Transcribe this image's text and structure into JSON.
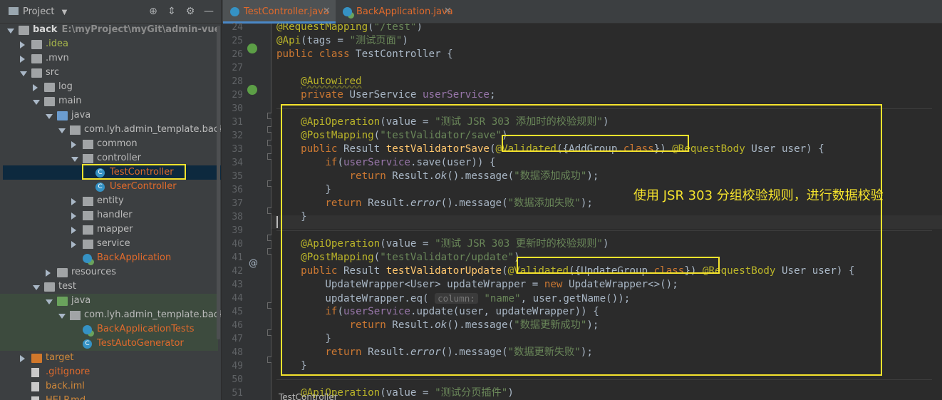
{
  "project_panel": {
    "title": "Project",
    "tree": [
      {
        "label": "back",
        "path": "E:\\myProject\\myGit\\admin-vue-template",
        "depth": 0,
        "arrow": "down",
        "icon": "folder"
      },
      {
        "label": ".idea",
        "depth": 1,
        "arrow": "right",
        "icon": "folder",
        "color": "olive"
      },
      {
        "label": ".mvn",
        "depth": 1,
        "arrow": "right",
        "icon": "folder"
      },
      {
        "label": "src",
        "depth": 1,
        "arrow": "down",
        "icon": "folder"
      },
      {
        "label": "log",
        "depth": 2,
        "arrow": "right",
        "icon": "folder"
      },
      {
        "label": "main",
        "depth": 2,
        "arrow": "down",
        "icon": "folder"
      },
      {
        "label": "java",
        "depth": 3,
        "arrow": "down",
        "icon": "folder-blue"
      },
      {
        "label": "com.lyh.admin_template.back",
        "depth": 4,
        "arrow": "down",
        "icon": "package"
      },
      {
        "label": "common",
        "depth": 5,
        "arrow": "right",
        "icon": "package"
      },
      {
        "label": "controller",
        "depth": 5,
        "arrow": "down",
        "icon": "package"
      },
      {
        "label": "TestController",
        "depth": 6,
        "arrow": "none",
        "icon": "class",
        "color": "orangered",
        "selected": true
      },
      {
        "label": "UserController",
        "depth": 6,
        "arrow": "none",
        "icon": "class",
        "color": "orangered"
      },
      {
        "label": "entity",
        "depth": 5,
        "arrow": "right",
        "icon": "package"
      },
      {
        "label": "handler",
        "depth": 5,
        "arrow": "right",
        "icon": "package"
      },
      {
        "label": "mapper",
        "depth": 5,
        "arrow": "right",
        "icon": "package"
      },
      {
        "label": "service",
        "depth": 5,
        "arrow": "right",
        "icon": "package"
      },
      {
        "label": "BackApplication",
        "depth": 5,
        "arrow": "none",
        "icon": "spring-class",
        "color": "orangered"
      },
      {
        "label": "resources",
        "depth": 3,
        "arrow": "right",
        "icon": "folder"
      },
      {
        "label": "test",
        "depth": 2,
        "arrow": "down",
        "icon": "folder"
      },
      {
        "label": "java",
        "depth": 3,
        "arrow": "down",
        "icon": "folder-green"
      },
      {
        "label": "com.lyh.admin_template.back",
        "depth": 4,
        "arrow": "down",
        "icon": "package"
      },
      {
        "label": "BackApplicationTests",
        "depth": 5,
        "arrow": "none",
        "icon": "spring-class",
        "color": "orangered"
      },
      {
        "label": "TestAutoGenerator",
        "depth": 5,
        "arrow": "none",
        "icon": "class",
        "color": "orangered"
      },
      {
        "label": "target",
        "depth": 1,
        "arrow": "right",
        "icon": "folder-orange",
        "color": "orange"
      },
      {
        "label": ".gitignore",
        "depth": 1,
        "arrow": "none",
        "icon": "file",
        "color": "orangered"
      },
      {
        "label": "back.iml",
        "depth": 1,
        "arrow": "none",
        "icon": "file",
        "color": "orange"
      },
      {
        "label": "HELP.md",
        "depth": 1,
        "arrow": "none",
        "icon": "file",
        "color": "orange"
      }
    ]
  },
  "tabs": [
    {
      "label": "TestController.java",
      "active": true
    },
    {
      "label": "BackApplication.java",
      "active": false
    }
  ],
  "editor": {
    "lines": [
      {
        "n": "24",
        "html": "<span class=\"an\">@RequestMapping</span>(<span class=\"st\">\"/test\"</span>)"
      },
      {
        "n": "25",
        "html": "<span class=\"an\">@Api</span>(tags = <span class=\"st\">\"测试页面\"</span>)"
      },
      {
        "n": "26",
        "html": "<span class=\"k\">public class</span> TestController {"
      },
      {
        "n": "27",
        "html": ""
      },
      {
        "n": "28",
        "html": "    <span class=\"an wavy\">@Autowired</span>"
      },
      {
        "n": "29",
        "html": "    <span class=\"k\">private</span> UserService <span class=\"fd\">userService</span>;"
      },
      {
        "n": "30",
        "html": ""
      },
      {
        "n": "31",
        "html": "    <span class=\"an\">@ApiOperation</span>(value = <span class=\"st\">\"测试 JSR 303 添加时的校验规则\"</span>)"
      },
      {
        "n": "32",
        "html": "    <span class=\"an\">@PostMapping</span>(<span class=\"st\">\"testValidator/save\"</span>)"
      },
      {
        "n": "33",
        "html": "    <span class=\"k\">public</span> Result <span class=\"fn\">testValidatorSave</span>(<span class=\"an\">@Validated</span>({AddGroup.<span class=\"k\">class</span>}) <span class=\"an\">@RequestBody</span> User user) {"
      },
      {
        "n": "34",
        "html": "        <span class=\"k\">if</span>(<span class=\"fd\">userService</span>.save(user)) {"
      },
      {
        "n": "35",
        "html": "            <span class=\"k\">return</span> Result.<span class=\"it\">ok</span>().message(<span class=\"st\">\"数据添加成功\"</span>);"
      },
      {
        "n": "36",
        "html": "        }"
      },
      {
        "n": "37",
        "html": "        <span class=\"k\">return</span> Result.<span class=\"it\">error</span>().message(<span class=\"st\">\"数据添加失败\"</span>);"
      },
      {
        "n": "38",
        "html": "    }"
      },
      {
        "n": "39",
        "html": ""
      },
      {
        "n": "40",
        "html": "    <span class=\"an\">@ApiOperation</span>(value = <span class=\"st\">\"测试 JSR 303 更新时的校验规则\"</span>)"
      },
      {
        "n": "41",
        "html": "    <span class=\"an\">@PostMapping</span>(<span class=\"st\">\"testValidator/update\"</span>)"
      },
      {
        "n": "42",
        "html": "    <span class=\"k\">public</span> Result <span class=\"fn\">testValidatorUpdate</span>(<span class=\"an\">@Validated</span>({UpdateGroup.<span class=\"k\">class</span>}) <span class=\"an\">@RequestBody</span> User user) {"
      },
      {
        "n": "43",
        "html": "        UpdateWrapper&lt;User&gt; updateWrapper = <span class=\"k\">new</span> UpdateWrapper&lt;&gt;();"
      },
      {
        "n": "44",
        "html": "        updateWrapper.eq( <span class=\"hint\">column:</span> <span class=\"st\">\"name\"</span>, user.getName());"
      },
      {
        "n": "45",
        "html": "        <span class=\"k\">if</span>(<span class=\"fd\">userService</span>.update(user, updateWrapper)) {"
      },
      {
        "n": "46",
        "html": "            <span class=\"k\">return</span> Result.<span class=\"it\">ok</span>().message(<span class=\"st\">\"数据更新成功\"</span>);"
      },
      {
        "n": "47",
        "html": "        }"
      },
      {
        "n": "48",
        "html": "        <span class=\"k\">return</span> Result.<span class=\"it\">error</span>().message(<span class=\"st\">\"数据更新失败\"</span>);"
      },
      {
        "n": "49",
        "html": "    }"
      },
      {
        "n": "50",
        "html": ""
      },
      {
        "n": "51",
        "html": "    <span class=\"an\">@ApiOperation</span>(value = <span class=\"st\">\"测试分页插件\"</span>)"
      }
    ],
    "annotation": "使用 JSR 303 分组校验规则，进行数据校验",
    "breadcrumb": "TestController"
  },
  "colors": {
    "highlight": "#f5e32d",
    "keyword": "#cc7832",
    "annotation": "#bbb529",
    "string": "#6a8759"
  }
}
